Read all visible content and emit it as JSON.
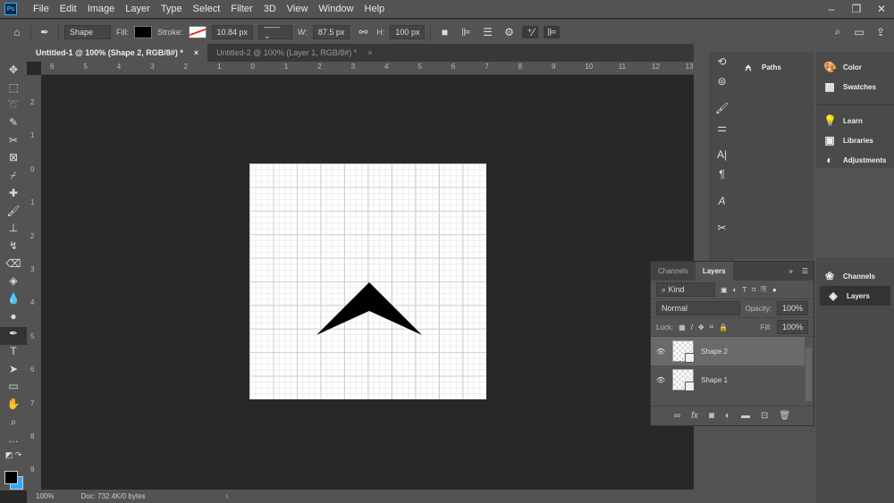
{
  "menu": [
    "File",
    "Edit",
    "Image",
    "Layer",
    "Type",
    "Select",
    "Filter",
    "3D",
    "View",
    "Window",
    "Help"
  ],
  "app_logo": "Ps",
  "options": {
    "mode": "Shape",
    "fill_label": "Fill:",
    "stroke_label": "Stroke:",
    "stroke_width": "10.84 px",
    "w_label": "W:",
    "w_value": "87.5 px",
    "h_label": "H:",
    "h_value": "100 px"
  },
  "tabs": [
    {
      "label": "Untitled-1 @ 100% (Shape 2, RGB/8#) *"
    },
    {
      "label": "Untitled-2 @ 100% (Layer 1, RGB/8#) *"
    }
  ],
  "ruler_top": [
    "6",
    "5",
    "4",
    "3",
    "2",
    "1",
    "0",
    "1",
    "2",
    "3",
    "4",
    "5",
    "6",
    "7",
    "8",
    "9",
    "10",
    "11",
    "12",
    "13"
  ],
  "ruler_left": [
    "2",
    "1",
    "0",
    "1",
    "2",
    "3",
    "4",
    "5",
    "6",
    "7",
    "8",
    "9"
  ],
  "status": {
    "zoom": "100%",
    "doc": "Doc: 732.4K/0 bytes"
  },
  "panels": {
    "paths": "Paths",
    "color": "Color",
    "swatches": "Swatches",
    "learn": "Learn",
    "libraries": "Libraries",
    "adjustments": "Adjustments",
    "channels": "Channels",
    "layers": "Layers"
  },
  "layers_panel": {
    "tab_channels": "Channels",
    "tab_layers": "Layers",
    "filter": "Kind",
    "blend": "Normal",
    "opacity_label": "Opacity:",
    "opacity": "100%",
    "lock_label": "Lock:",
    "fill_label": "Fill:",
    "fill": "100%",
    "layers": [
      {
        "name": "Shape 2",
        "selected": true
      },
      {
        "name": "Shape 1",
        "selected": false
      }
    ]
  },
  "colors": {
    "foreground": "#000000",
    "background": "#31a8ff"
  }
}
